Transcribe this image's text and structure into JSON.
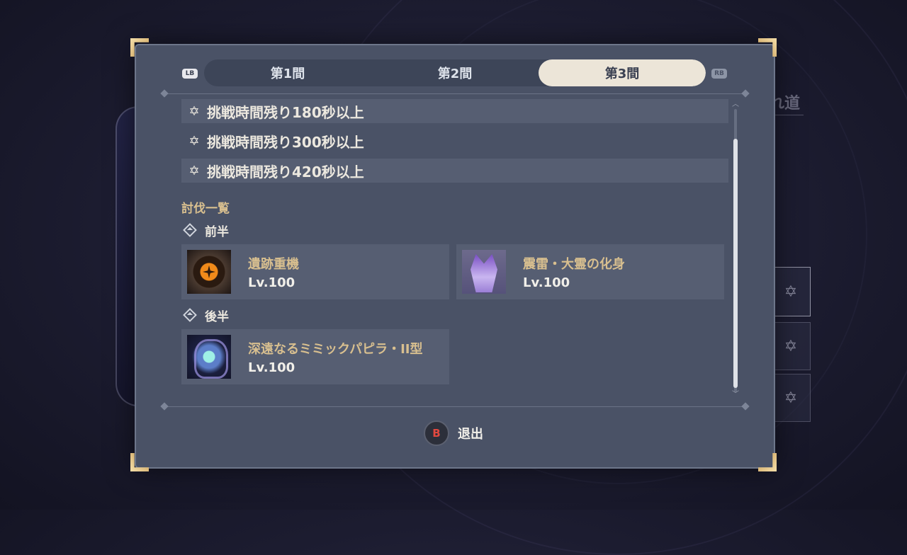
{
  "background": {
    "right_text": "れ道"
  },
  "tabs": [
    {
      "label": "第1間",
      "active": false
    },
    {
      "label": "第2間",
      "active": false
    },
    {
      "label": "第3間",
      "active": true
    }
  ],
  "shoulder_buttons": {
    "left": "LB",
    "right": "RB"
  },
  "conditions": [
    {
      "icon": "star-icon",
      "text": "挑戦時間残り180秒以上"
    },
    {
      "icon": "star-icon",
      "text": "挑戦時間残り300秒以上"
    },
    {
      "icon": "star-icon",
      "text": "挑戦時間残り420秒以上"
    }
  ],
  "enemy_list": {
    "title": "討伐一覧",
    "first_half": {
      "label": "前半",
      "enemies": [
        {
          "name": "遺跡重機",
          "level": "Lv.100",
          "portrait": "ruin-machine"
        },
        {
          "name": "震雷・大霊の化身",
          "level": "Lv.100",
          "portrait": "raiden-shogun-puppet"
        }
      ]
    },
    "second_half": {
      "label": "後半",
      "enemies": [
        {
          "name": "深遠なるミミックパピラ・II型",
          "level": "Lv.100",
          "portrait": "mimic-papilla"
        }
      ]
    }
  },
  "footer": {
    "button_glyph": "B",
    "button_label": "退出"
  },
  "colors": {
    "dialog_bg": "#4a5266",
    "active_tab": "#ece5d8",
    "accent_gold": "#d8bf8f",
    "b_button_red": "#e2483f"
  }
}
